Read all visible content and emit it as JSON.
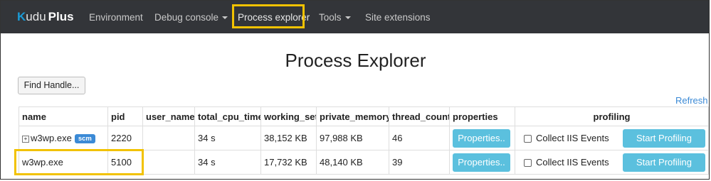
{
  "brand": {
    "k": "K",
    "udu": "udu",
    "plus": "Plus"
  },
  "nav": {
    "items": [
      {
        "label": "Environment"
      },
      {
        "label": "Debug console"
      },
      {
        "label": "Process explorer"
      },
      {
        "label": "Tools"
      },
      {
        "label": "Site extensions"
      }
    ]
  },
  "page": {
    "title": "Process Explorer"
  },
  "toolbar": {
    "find_handle": "Find Handle...",
    "refresh": "Refresh"
  },
  "table": {
    "headers": [
      "name",
      "pid",
      "user_name",
      "total_cpu_time",
      "working_set",
      "private_memory",
      "thread_count",
      "properties",
      "profiling"
    ],
    "rows": [
      {
        "expand": "+",
        "name": "w3wp.exe",
        "badge": "scm",
        "pid": "2220",
        "user_name": "",
        "total_cpu_time": "34 s",
        "working_set": "38,152 KB",
        "private_memory": "97,988 KB",
        "thread_count": "46",
        "properties_btn": "Properties..",
        "collect_label": "Collect IIS Events",
        "profile_btn": "Start Profiling"
      },
      {
        "name": "w3wp.exe",
        "pid": "5100",
        "user_name": "",
        "total_cpu_time": "34 s",
        "working_set": "17,732 KB",
        "private_memory": "48,140 KB",
        "thread_count": "39",
        "properties_btn": "Properties..",
        "collect_label": "Collect IIS Events",
        "profile_btn": "Start Profiling"
      }
    ]
  },
  "colors": {
    "highlight": "#f2c200",
    "navbar": "#333539",
    "accent": "#5bc0de",
    "link": "#3b8ad6"
  }
}
